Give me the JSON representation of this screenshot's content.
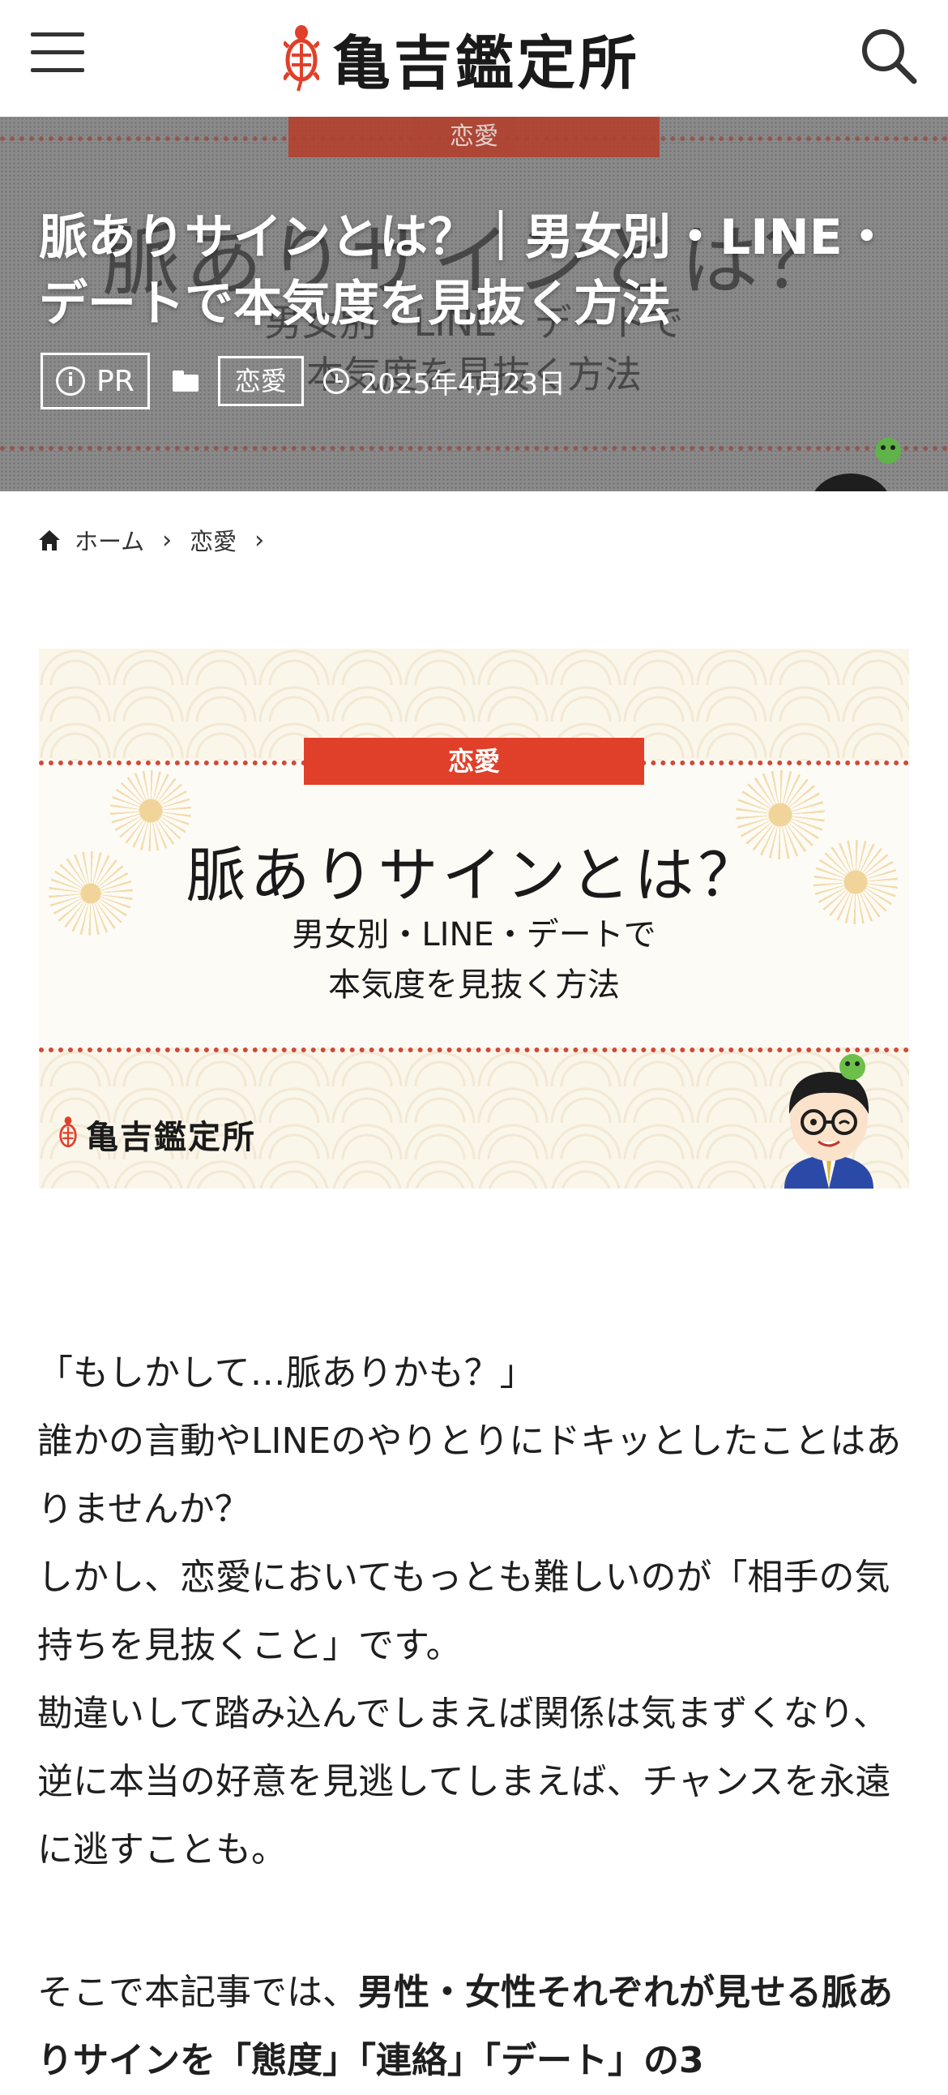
{
  "header": {
    "logo_text": "亀吉鑑定所",
    "menu_icon": "hamburger-menu-icon",
    "search_icon": "search-icon"
  },
  "hero": {
    "category_band": "恋愛",
    "title": "脈ありサインとは？｜男女別・LINE・デートで本気度を見抜く方法",
    "ghost_title": "脈ありサインとは？",
    "ghost_sub1": "男女別・LINE・デートで",
    "ghost_sub2": "本気度を見抜く方法",
    "pr_label": "PR",
    "category_label": "恋愛",
    "date": "2025年4月23日"
  },
  "breadcrumb": {
    "home": "ホーム",
    "category": "恋愛"
  },
  "feature_image": {
    "category": "恋愛",
    "title": "脈ありサインとは？",
    "sub1": "男女別・LINE・デートで",
    "sub2": "本気度を見抜く方法",
    "logo_text": "亀吉鑑定所"
  },
  "article": {
    "p1_line1": "「もしかして…脈ありかも？」",
    "p1_line2": "誰かの言動やLINEのやりとりにドキッとしたことはありませんか？",
    "p1_line3": "しかし、恋愛においてもっとも難しいのが「相手の気持ちを見抜くこと」です。",
    "p1_line4": "勘違いして踏み込んでしまえば関係は気まずくなり、逆に本当の好意を見逃してしまえば、チャンスを永遠に逃すことも。",
    "p2_lead": "そこで本記事では、",
    "p2_bold": "男性・女性それぞれが見せる脈ありサインを「態度」「連絡」「デート」の3"
  },
  "colors": {
    "accent_red": "#e0402a",
    "hero_overlay": "#8a8a8a",
    "text": "#1f1f1f"
  }
}
